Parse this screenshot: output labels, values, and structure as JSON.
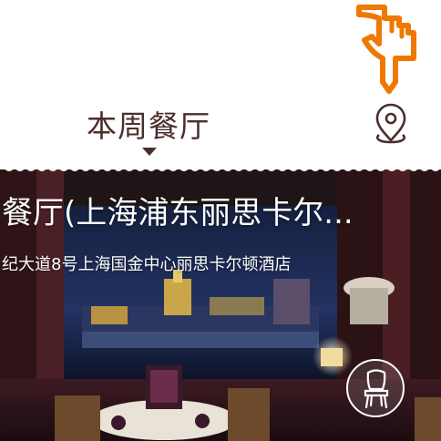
{
  "header": {
    "title": "本周餐厅",
    "hand_icon": "pointing-hand-icon",
    "location_icon": "map-pin-icon",
    "accent_color": "#f07800"
  },
  "restaurant": {
    "name": "餐厅(上海浦东丽思卡尔...",
    "address": "纪大道8号上海国金中心丽思卡尔顿酒店",
    "chair_icon": "chair-icon"
  }
}
